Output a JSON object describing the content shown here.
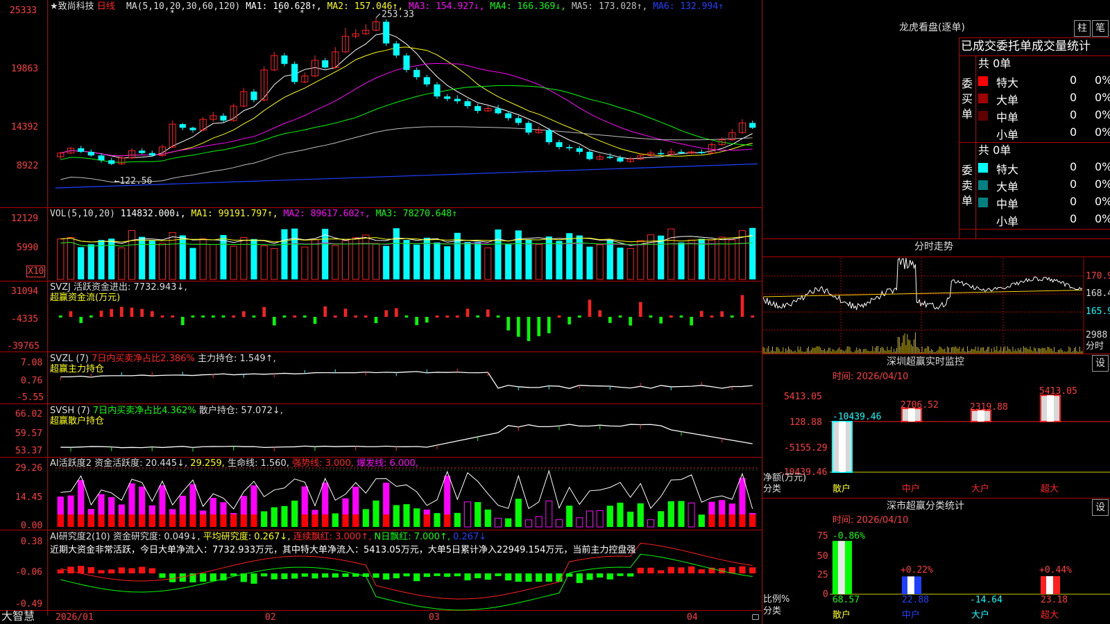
{
  "app": {
    "brand": "大智慧",
    "stock_title": "★致尚科技",
    "period": "日线",
    "lock_icon": "lock-icon"
  },
  "colors": {
    "up": "#ff2020",
    "down": "#00ffff",
    "bg": "#000000",
    "grid": "#b00000",
    "axis_text": "#ff3b3b",
    "ma1": "#ffffff",
    "ma2": "#ffff00",
    "ma3": "#ff00ff",
    "ma4": "#00ff00",
    "ma5": "#c0c0c0",
    "ma6": "#2040ff"
  },
  "main": {
    "axis": [
      "25333",
      "19863",
      "14392",
      "8922"
    ],
    "legend": [
      {
        "text": "MA(5,10,20,30,60,120)",
        "color": "#dddddd"
      },
      {
        "text": "MA1: 160.628↑,",
        "color": "#ffffff"
      },
      {
        "text": "MA2: 157.046↑,",
        "color": "#ffff00"
      },
      {
        "text": "MA3: 154.927↓,",
        "color": "#ff00ff"
      },
      {
        "text": "MA4: 166.369↓,",
        "color": "#00ff00"
      },
      {
        "text": "MA5: 173.028↑,",
        "color": "#c0c0c0"
      },
      {
        "text": "MA6: 132.994↑",
        "color": "#2040ff"
      }
    ],
    "high_mark": "253.33",
    "low_mark": "122.56",
    "stars": [
      "*",
      "*",
      "*"
    ]
  },
  "vol": {
    "axis": [
      "12129",
      "5990",
      "X10"
    ],
    "legend": [
      {
        "text": "VOL(5,10,20)",
        "color": "#dddddd"
      },
      {
        "text": "114832.000↓,",
        "color": "#ffffff"
      },
      {
        "text": "MA1: 99191.797↑,",
        "color": "#ffff00"
      },
      {
        "text": "MA2: 89617.602↑,",
        "color": "#ff00ff"
      },
      {
        "text": "MA3: 78270.648↑",
        "color": "#00ff00"
      }
    ]
  },
  "svzj": {
    "axis": [
      "31094",
      "-4335",
      "-39765"
    ],
    "title": "SVZJ",
    "l1": "活跃资金进出: 7732.943↓,",
    "l2": "超赢资金流(万元)"
  },
  "svzl": {
    "axis": [
      "7.08",
      "0.76",
      "-5.55"
    ],
    "title": "SVZL (7)",
    "a": "7日内买卖净占比2.386%",
    "b": "主力持仓: 1.549↑,",
    "l2": "超赢主力持仓"
  },
  "svsh": {
    "axis": [
      "66.02",
      "59.57",
      "53.37"
    ],
    "title": "SVSH (7)",
    "a": "7日内买卖净占比4.362%",
    "b": "散户持仓: 57.072↓,",
    "l2": "超赢散户持仓"
  },
  "aihy": {
    "axis": [
      "29.26",
      "14.45",
      "0.00"
    ],
    "legend": [
      {
        "text": "AI活跃度2 资金活跃度: 20.445↓,",
        "color": "#dddddd"
      },
      {
        "text": "29.259,",
        "color": "#ffff00"
      },
      {
        "text": "生命线: 1.560,",
        "color": "#dddddd"
      },
      {
        "text": "强势线: 3.000,",
        "color": "#ff2020"
      },
      {
        "text": "爆发线: 6.000,",
        "color": "#ff00ff"
      }
    ]
  },
  "aiyj": {
    "axis": [
      "0.38",
      "-0.06",
      "-0.49"
    ],
    "legend": [
      {
        "text": "AI研究度2(10) 资金研究度: 0.049↓,",
        "color": "#dddddd"
      },
      {
        "text": "平均研究度: 0.267↓,",
        "color": "#ffff00"
      },
      {
        "text": "连续飘红: 3.000↑,",
        "color": "#ff2020"
      },
      {
        "text": "N日飘红: 7.000↑,",
        "color": "#00ff00"
      },
      {
        "text": "0.267↓",
        "color": "#2040ff"
      }
    ],
    "summary": "近期大资金非常活跃，今日大单净流入：7732.933万元，其中特大单净流入：5413.05万元，大单5日累计净入22949.154万元，当前主力控盘强"
  },
  "xaxis": [
    "2026/01",
    "02",
    "03",
    "04"
  ],
  "dragon": {
    "title": "龙虎看盘(逐单)",
    "btn_bar": "柱",
    "btn_pen": "笔",
    "subtitle": "已成交委托单成交量统计",
    "buy_label": "委买单",
    "sell_label": "委卖单",
    "buy_total": "共 0单",
    "sell_total": "共 0单",
    "buy_rows": [
      {
        "name": "特大",
        "qty": "0",
        "pct": "0%",
        "color": "#ff0000"
      },
      {
        "name": "大单",
        "qty": "0",
        "pct": "0%",
        "color": "#a00000"
      },
      {
        "name": "中单",
        "qty": "0",
        "pct": "0%",
        "color": "#600000"
      },
      {
        "name": "小单",
        "qty": "0",
        "pct": "0%",
        "color": ""
      }
    ],
    "sell_rows": [
      {
        "name": "特大",
        "qty": "0",
        "pct": "0%",
        "color": "#00ffff"
      },
      {
        "name": "大单",
        "qty": "0",
        "pct": "0%",
        "color": "#008080"
      },
      {
        "name": "中单",
        "qty": "0",
        "pct": "0%",
        "color": "#008080"
      },
      {
        "name": "小单",
        "qty": "0",
        "pct": "0%",
        "color": ""
      }
    ]
  },
  "intraday": {
    "title": "分时走势",
    "p_high": "170.9",
    "p_mid": "168.4",
    "p_low": "165.9",
    "vol_top": "2988",
    "vol_unit": "分时"
  },
  "sz_monitor": {
    "title": "深圳超赢实时监控",
    "settings": "设",
    "time": "时间: 2026/04/10",
    "axis": [
      "5413.05",
      "128.88",
      "-5155.29",
      "-10439.46"
    ],
    "ylabel1": "净额(万元)",
    "ylabel2": "分类",
    "categories": [
      "散户",
      "中户",
      "大户",
      "超大"
    ],
    "values": [
      -10439.46,
      2706.52,
      2319.88,
      5413.05
    ],
    "value_labels": [
      "-10439.46",
      "2706.52",
      "2319.88",
      "5413.05"
    ]
  },
  "sz_class": {
    "title": "深市超赢分类统计",
    "settings": "设",
    "time": "时间: 2026/04/10",
    "axis": [
      "75",
      "50",
      "25",
      "0"
    ],
    "ylabel1": "比例%",
    "ylabel2": "分类",
    "categories": [
      "散户",
      "中户",
      "大户",
      "超大"
    ],
    "changes": [
      "-0.86%",
      "+0.22%",
      "",
      "+0.44%"
    ],
    "values": [
      68.57,
      22.88,
      -14.64,
      23.18
    ],
    "value_labels": [
      "68.57",
      "22.88",
      "-14.64",
      "23.18"
    ]
  },
  "chart_data": [
    {
      "type": "candlestick",
      "title": "★致尚科技 日线",
      "ylim": [
        8922,
        25333
      ],
      "high": 253.33,
      "low": 122.56,
      "x": [
        "2026/01",
        "02",
        "03",
        "04"
      ],
      "series": [
        {
          "name": "MA1",
          "values": [
            160.628
          ]
        },
        {
          "name": "MA2",
          "values": [
            157.046
          ]
        },
        {
          "name": "MA3",
          "values": [
            154.927
          ]
        },
        {
          "name": "MA4",
          "values": [
            166.369
          ]
        },
        {
          "name": "MA5",
          "values": [
            173.028
          ]
        },
        {
          "name": "MA6",
          "values": [
            132.994
          ]
        }
      ],
      "candles": [
        [
          138,
          141,
          136,
          142
        ],
        [
          141,
          145,
          140,
          146
        ],
        [
          145,
          142,
          141,
          147
        ],
        [
          142,
          139,
          138,
          144
        ],
        [
          139,
          135,
          133,
          141
        ],
        [
          135,
          132,
          131,
          137
        ],
        [
          132,
          137,
          131,
          138
        ],
        [
          137,
          143,
          136,
          145
        ],
        [
          143,
          141,
          140,
          145
        ],
        [
          141,
          139,
          138,
          143
        ],
        [
          139,
          146,
          138,
          148
        ],
        [
          146,
          165,
          145,
          168
        ],
        [
          165,
          162,
          160,
          166
        ],
        [
          162,
          160,
          158,
          163
        ],
        [
          160,
          169,
          159,
          171
        ],
        [
          169,
          172,
          167,
          175
        ],
        [
          172,
          168,
          166,
          174
        ],
        [
          168,
          180,
          167,
          182
        ],
        [
          180,
          192,
          179,
          195
        ],
        [
          192,
          185,
          183,
          194
        ],
        [
          185,
          210,
          184,
          213
        ],
        [
          210,
          222,
          209,
          225
        ],
        [
          222,
          215,
          213,
          224
        ],
        [
          215,
          200,
          198,
          217
        ],
        [
          200,
          205,
          199,
          208
        ],
        [
          205,
          218,
          204,
          222
        ],
        [
          218,
          212,
          211,
          220
        ],
        [
          212,
          225,
          211,
          229
        ],
        [
          225,
          238,
          224,
          245
        ],
        [
          238,
          240,
          236,
          244
        ],
        [
          240,
          243,
          239,
          248
        ],
        [
          243,
          250,
          242,
          253.33
        ],
        [
          250,
          232,
          230,
          252
        ],
        [
          232,
          222,
          220,
          234
        ],
        [
          222,
          210,
          208,
          224
        ],
        [
          210,
          204,
          202,
          212
        ],
        [
          204,
          198,
          196,
          206
        ],
        [
          198,
          188,
          186,
          200
        ],
        [
          188,
          186,
          184,
          190
        ],
        [
          186,
          184,
          182,
          189
        ],
        [
          184,
          180,
          178,
          186
        ],
        [
          180,
          176,
          174,
          182
        ],
        [
          176,
          178,
          175,
          180
        ],
        [
          178,
          174,
          173,
          181
        ],
        [
          174,
          170,
          168,
          176
        ],
        [
          170,
          166,
          164,
          172
        ],
        [
          166,
          158,
          156,
          168
        ],
        [
          158,
          160,
          157,
          163
        ],
        [
          160,
          150,
          148,
          162
        ],
        [
          150,
          146,
          144,
          152
        ],
        [
          146,
          145,
          143,
          148
        ],
        [
          145,
          142,
          140,
          147
        ],
        [
          142,
          136,
          135,
          144
        ],
        [
          136,
          138,
          135,
          140
        ],
        [
          138,
          137,
          136,
          141
        ],
        [
          137,
          134,
          133,
          139
        ],
        [
          134,
          136,
          133,
          138
        ],
        [
          136,
          139,
          135,
          141
        ],
        [
          139,
          141,
          138,
          143
        ],
        [
          141,
          140,
          139,
          144
        ],
        [
          140,
          142,
          139,
          145
        ],
        [
          142,
          141,
          140,
          144
        ],
        [
          141,
          142,
          140,
          143
        ],
        [
          142,
          141,
          140,
          144
        ],
        [
          141,
          148,
          140,
          150
        ],
        [
          148,
          152,
          147,
          154
        ],
        [
          152,
          158,
          151,
          161
        ],
        [
          158,
          166,
          157,
          169
        ],
        [
          166,
          162,
          161,
          168
        ]
      ]
    },
    {
      "type": "bar",
      "title": "VOL(5,10,20)",
      "series": [
        {
          "name": "MA1",
          "values": [
            99191.797
          ]
        },
        {
          "name": "MA2",
          "values": [
            89617.602
          ]
        },
        {
          "name": "MA3",
          "values": [
            78270.648
          ]
        }
      ],
      "values": [
        114832.0
      ],
      "ylim": [
        0,
        12129
      ]
    },
    {
      "type": "bar",
      "title": "超赢资金流(万元)",
      "ylim": [
        -39765,
        31094
      ],
      "values": [
        7732.943
      ]
    },
    {
      "type": "line",
      "title": "超赢主力持仓",
      "ylim": [
        -5.55,
        7.08
      ],
      "values": [
        1.549
      ]
    },
    {
      "type": "line",
      "title": "超赢散户持仓",
      "ylim": [
        53.37,
        66.02
      ],
      "values": [
        57.072
      ]
    },
    {
      "type": "bar",
      "title": "AI活跃度2",
      "ylim": [
        0,
        29.26
      ],
      "values": [
        20.445,
        29.259
      ]
    },
    {
      "type": "bar",
      "title": "AI研究度2(10)",
      "ylim": [
        -0.49,
        0.38
      ],
      "values": [
        0.049,
        0.267
      ]
    },
    {
      "type": "bar",
      "title": "深圳超赢实时监控",
      "categories": [
        "散户",
        "中户",
        "大户",
        "超大"
      ],
      "values": [
        -10439.46,
        2706.52,
        2319.88,
        5413.05
      ],
      "ylim": [
        -10439.46,
        5413.05
      ],
      "ylabel": "净额(万元)"
    },
    {
      "type": "bar",
      "title": "深市超赢分类统计",
      "categories": [
        "散户",
        "中户",
        "大户",
        "超大"
      ],
      "values": [
        68.57,
        22.88,
        -14.64,
        23.18
      ],
      "ylim": [
        0,
        75
      ],
      "ylabel": "比例%"
    }
  ]
}
